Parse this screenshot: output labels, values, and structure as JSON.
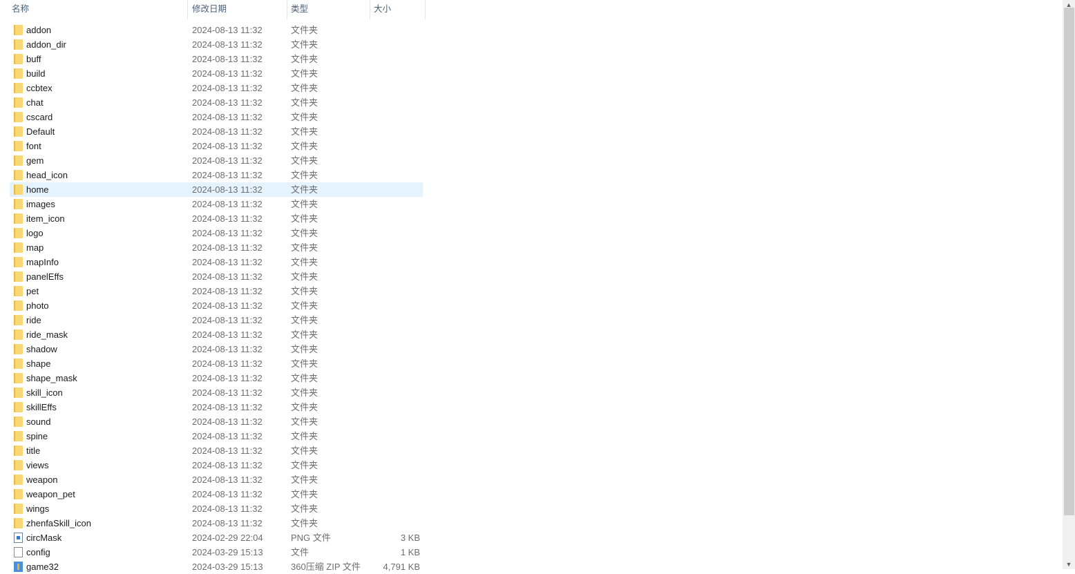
{
  "columns": {
    "name": "名称",
    "date": "修改日期",
    "type": "类型",
    "size": "大小"
  },
  "selected_index": 11,
  "selection_color": "#e5f3ff",
  "files": [
    {
      "name": "addon",
      "date": "2024-08-13 11:32",
      "type": "文件夹",
      "size": "",
      "icon": "folder-icon"
    },
    {
      "name": "addon_dir",
      "date": "2024-08-13 11:32",
      "type": "文件夹",
      "size": "",
      "icon": "folder-icon"
    },
    {
      "name": "buff",
      "date": "2024-08-13 11:32",
      "type": "文件夹",
      "size": "",
      "icon": "folder-icon"
    },
    {
      "name": "build",
      "date": "2024-08-13 11:32",
      "type": "文件夹",
      "size": "",
      "icon": "folder-icon"
    },
    {
      "name": "ccbtex",
      "date": "2024-08-13 11:32",
      "type": "文件夹",
      "size": "",
      "icon": "folder-icon"
    },
    {
      "name": "chat",
      "date": "2024-08-13 11:32",
      "type": "文件夹",
      "size": "",
      "icon": "folder-icon"
    },
    {
      "name": "cscard",
      "date": "2024-08-13 11:32",
      "type": "文件夹",
      "size": "",
      "icon": "folder-icon"
    },
    {
      "name": "Default",
      "date": "2024-08-13 11:32",
      "type": "文件夹",
      "size": "",
      "icon": "folder-icon"
    },
    {
      "name": "font",
      "date": "2024-08-13 11:32",
      "type": "文件夹",
      "size": "",
      "icon": "folder-icon"
    },
    {
      "name": "gem",
      "date": "2024-08-13 11:32",
      "type": "文件夹",
      "size": "",
      "icon": "folder-icon"
    },
    {
      "name": "head_icon",
      "date": "2024-08-13 11:32",
      "type": "文件夹",
      "size": "",
      "icon": "folder-icon"
    },
    {
      "name": "home",
      "date": "2024-08-13 11:32",
      "type": "文件夹",
      "size": "",
      "icon": "folder-icon"
    },
    {
      "name": "images",
      "date": "2024-08-13 11:32",
      "type": "文件夹",
      "size": "",
      "icon": "folder-icon"
    },
    {
      "name": "item_icon",
      "date": "2024-08-13 11:32",
      "type": "文件夹",
      "size": "",
      "icon": "folder-icon"
    },
    {
      "name": "logo",
      "date": "2024-08-13 11:32",
      "type": "文件夹",
      "size": "",
      "icon": "folder-icon"
    },
    {
      "name": "map",
      "date": "2024-08-13 11:32",
      "type": "文件夹",
      "size": "",
      "icon": "folder-icon"
    },
    {
      "name": "mapInfo",
      "date": "2024-08-13 11:32",
      "type": "文件夹",
      "size": "",
      "icon": "folder-icon"
    },
    {
      "name": "panelEffs",
      "date": "2024-08-13 11:32",
      "type": "文件夹",
      "size": "",
      "icon": "folder-icon"
    },
    {
      "name": "pet",
      "date": "2024-08-13 11:32",
      "type": "文件夹",
      "size": "",
      "icon": "folder-icon"
    },
    {
      "name": "photo",
      "date": "2024-08-13 11:32",
      "type": "文件夹",
      "size": "",
      "icon": "folder-icon"
    },
    {
      "name": "ride",
      "date": "2024-08-13 11:32",
      "type": "文件夹",
      "size": "",
      "icon": "folder-icon"
    },
    {
      "name": "ride_mask",
      "date": "2024-08-13 11:32",
      "type": "文件夹",
      "size": "",
      "icon": "folder-icon"
    },
    {
      "name": "shadow",
      "date": "2024-08-13 11:32",
      "type": "文件夹",
      "size": "",
      "icon": "folder-icon"
    },
    {
      "name": "shape",
      "date": "2024-08-13 11:32",
      "type": "文件夹",
      "size": "",
      "icon": "folder-icon"
    },
    {
      "name": "shape_mask",
      "date": "2024-08-13 11:32",
      "type": "文件夹",
      "size": "",
      "icon": "folder-icon"
    },
    {
      "name": "skill_icon",
      "date": "2024-08-13 11:32",
      "type": "文件夹",
      "size": "",
      "icon": "folder-icon"
    },
    {
      "name": "skillEffs",
      "date": "2024-08-13 11:32",
      "type": "文件夹",
      "size": "",
      "icon": "folder-icon"
    },
    {
      "name": "sound",
      "date": "2024-08-13 11:32",
      "type": "文件夹",
      "size": "",
      "icon": "folder-icon"
    },
    {
      "name": "spine",
      "date": "2024-08-13 11:32",
      "type": "文件夹",
      "size": "",
      "icon": "folder-icon"
    },
    {
      "name": "title",
      "date": "2024-08-13 11:32",
      "type": "文件夹",
      "size": "",
      "icon": "folder-icon"
    },
    {
      "name": "views",
      "date": "2024-08-13 11:32",
      "type": "文件夹",
      "size": "",
      "icon": "folder-icon"
    },
    {
      "name": "weapon",
      "date": "2024-08-13 11:32",
      "type": "文件夹",
      "size": "",
      "icon": "folder-icon"
    },
    {
      "name": "weapon_pet",
      "date": "2024-08-13 11:32",
      "type": "文件夹",
      "size": "",
      "icon": "folder-icon"
    },
    {
      "name": "wings",
      "date": "2024-08-13 11:32",
      "type": "文件夹",
      "size": "",
      "icon": "folder-icon"
    },
    {
      "name": "zhenfaSkill_icon",
      "date": "2024-08-13 11:32",
      "type": "文件夹",
      "size": "",
      "icon": "folder-icon"
    },
    {
      "name": "circMask",
      "date": "2024-02-29 22:04",
      "type": "PNG 文件",
      "size": "3 KB",
      "icon": "png-file-icon"
    },
    {
      "name": "config",
      "date": "2024-03-29 15:13",
      "type": "文件",
      "size": "1 KB",
      "icon": "file-icon"
    },
    {
      "name": "game32",
      "date": "2024-03-29 15:13",
      "type": "360压缩 ZIP 文件",
      "size": "4,791 KB",
      "icon": "zip-file-icon"
    }
  ]
}
